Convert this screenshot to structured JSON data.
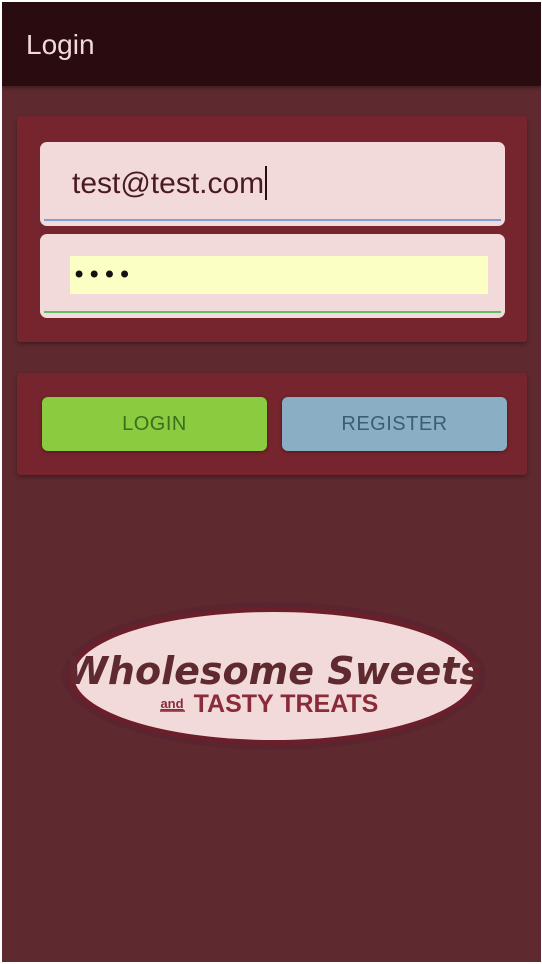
{
  "app_bar": {
    "title": "Login"
  },
  "login_form": {
    "email": {
      "value": "test@test.com"
    },
    "password": {
      "masked_value": "••••"
    }
  },
  "actions": {
    "login_label": "LOGIN",
    "register_label": "REGISTER"
  },
  "logo": {
    "line1": "Wholesome Sweets",
    "and": "and",
    "line2": "TASTY TREATS"
  },
  "colors": {
    "background": "#5e2a2f",
    "app_bar": "#2a0b10",
    "card": "#76242d",
    "field": "#f2dada",
    "login_button": "#8acb40",
    "register_button": "#8aaec4"
  }
}
